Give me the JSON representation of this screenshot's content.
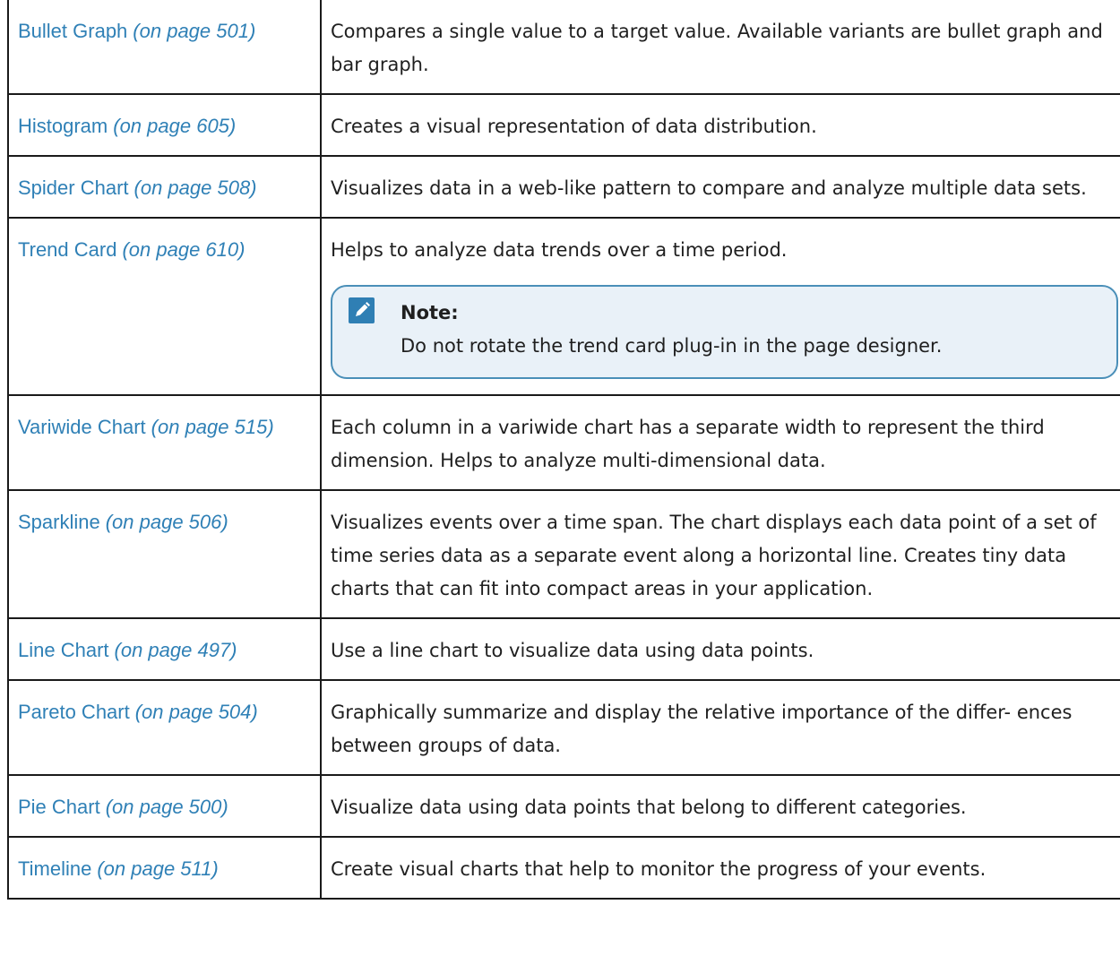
{
  "rows": [
    {
      "name": "Bullet Graph",
      "page_ref": "(on page 501)",
      "description": "Compares a single value to a target value. Available variants are bullet graph and bar graph."
    },
    {
      "name": "Histogram",
      "page_ref": "(on page 605)",
      "description": "Creates a visual representation of data distribution."
    },
    {
      "name": "Spider Chart",
      "page_ref": "(on page 508)",
      "description": "Visualizes data in a web-like pattern to compare and analyze multiple data sets."
    },
    {
      "name": "Trend Card",
      "page_ref": "(on page 610)",
      "description": "Helps to analyze data trends over a time period.",
      "note_title": "Note:",
      "note_text": "Do not rotate the trend card plug-in in the page designer."
    },
    {
      "name": "Variwide Chart",
      "page_ref": "(on page 515)",
      "description": "Each column in a variwide chart has a separate width to represent the third dimension. Helps to analyze multi-dimensional data."
    },
    {
      "name": "Sparkline",
      "page_ref": "(on page 506)",
      "description": "Visualizes events over a time span. The chart displays each data point of a set of time series data as a separate event along a horizontal line. Creates tiny data charts that can fit into compact areas in your application."
    },
    {
      "name": "Line Chart",
      "page_ref": "(on page 497)",
      "description": "Use a line chart to visualize data using data points."
    },
    {
      "name": "Pareto Chart",
      "page_ref": "(on page 504)",
      "description": "Graphically summarize and display the relative importance of the differ- ences between groups of data."
    },
    {
      "name": "Pie Chart",
      "page_ref": "(on page 500)",
      "description": "Visualize data using data points that belong to different categories."
    },
    {
      "name": "Timeline",
      "page_ref": "(on page 511)",
      "description": "Create visual charts that help to monitor the progress of your events."
    }
  ],
  "icons": {
    "note": "pencil-icon"
  },
  "colors": {
    "link": "#2f80b6",
    "note_border": "#4a8fb8",
    "note_background": "#e9f1f8",
    "note_icon": "#2f7fb4"
  }
}
